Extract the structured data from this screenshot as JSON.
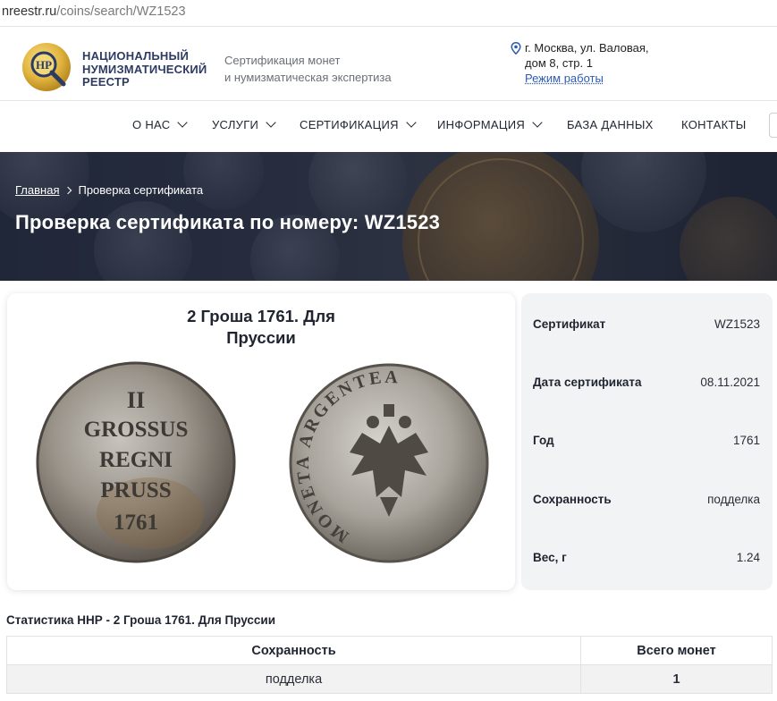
{
  "browser": {
    "url_host": "nreestr.ru",
    "url_path": "/coins/search/WZ1523"
  },
  "header": {
    "logo_icon": "nnr-magnifier-logo",
    "logo_text": "НР",
    "brand_lines": [
      "НАЦИОНАЛЬНЫЙ",
      "НУМИЗМАТИЧЕСКИЙ",
      "РЕЕСТР"
    ],
    "tagline_lines": [
      "Сертификация монет",
      "и нумизматическая экспертиза"
    ],
    "address_line1": "г. Москва, ул. Валовая,",
    "address_line2": "дом 8, стр. 1",
    "hours_link": "Режим работы",
    "accent_color": "#2d3b63"
  },
  "nav": {
    "items": [
      {
        "label": "О НАС",
        "has_dropdown": true
      },
      {
        "label": "УСЛУГИ",
        "has_dropdown": true
      },
      {
        "label": "СЕРТИФИКАЦИЯ",
        "has_dropdown": true
      },
      {
        "label": "ИНФОРМАЦИЯ",
        "has_dropdown": true
      },
      {
        "label": "БАЗА ДАННЫХ",
        "has_dropdown": false
      },
      {
        "label": "КОНТАКТЫ",
        "has_dropdown": false
      }
    ]
  },
  "hero": {
    "breadcrumb_home": "Главная",
    "breadcrumb_current": "Проверка сертификата",
    "title": "Проверка сертификата по номеру: WZ1523"
  },
  "coin": {
    "title_line1": "2 Гроша 1761. Для",
    "title_line2": "Пруссии",
    "obverse_legend": [
      "II",
      "GROSSUS",
      "REGNI",
      "PRUSS",
      "1761"
    ],
    "reverse_legend": "MONETA ARGENTEA"
  },
  "certificate": {
    "rows": [
      {
        "label": "Сертификат",
        "value": "WZ1523"
      },
      {
        "label": "Дата сертификата",
        "value": "08.11.2021"
      },
      {
        "label": "Год",
        "value": "1761"
      },
      {
        "label": "Сохранность",
        "value": "подделка"
      },
      {
        "label": "Вес, г",
        "value": "1.24"
      }
    ]
  },
  "stats": {
    "title": "Статистика ННР - 2 Гроша 1761. Для Пруссии",
    "col_condition": "Сохранность",
    "col_total": "Всего монет",
    "rows": [
      {
        "condition": "подделка",
        "total": "1"
      }
    ]
  }
}
